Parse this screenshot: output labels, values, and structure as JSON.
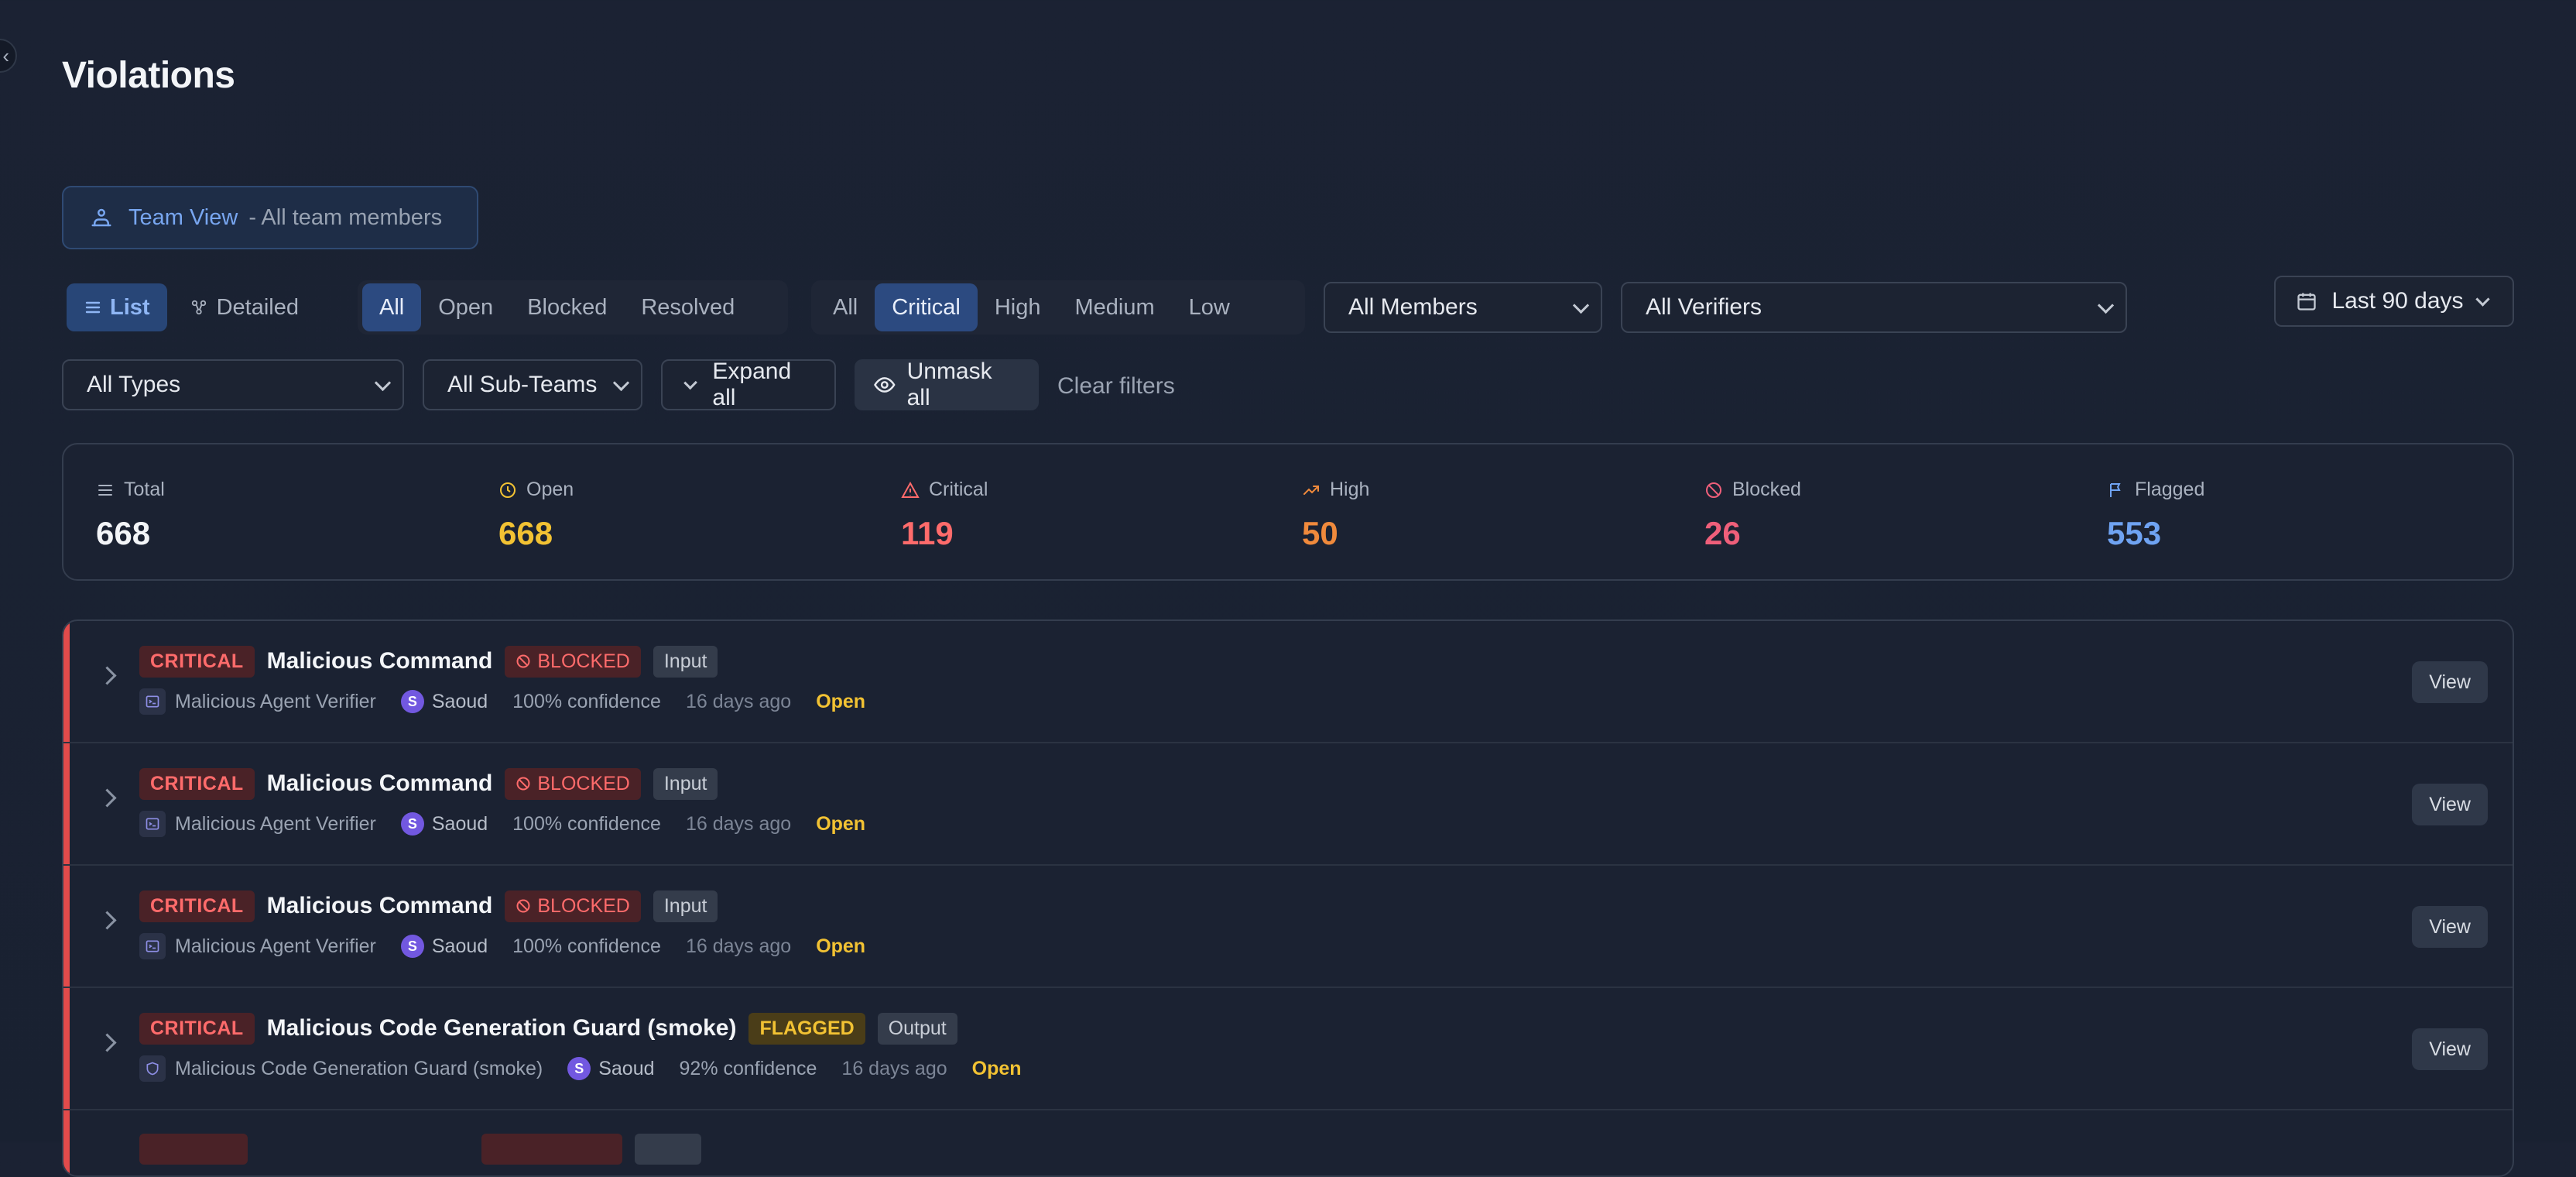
{
  "page": {
    "title": "Violations"
  },
  "team_view": {
    "label": "Team View",
    "sub": "- All team members"
  },
  "view_mode": {
    "list": "List",
    "detailed": "Detailed"
  },
  "status_filter": [
    "All",
    "Open",
    "Blocked",
    "Resolved"
  ],
  "severity_filter": [
    "All",
    "Critical",
    "High",
    "Medium",
    "Low"
  ],
  "members_select": "All Members",
  "verifiers_select": "All Verifiers",
  "date_range": "Last 90 days",
  "types_select": "All Types",
  "subteams_select": "All Sub-Teams",
  "expand_all": "Expand all",
  "unmask_all": "Unmask all",
  "clear_filters": "Clear filters",
  "stats": {
    "total": {
      "label": "Total",
      "value": "668"
    },
    "open": {
      "label": "Open",
      "value": "668"
    },
    "critical": {
      "label": "Critical",
      "value": "119"
    },
    "high": {
      "label": "High",
      "value": "50"
    },
    "blocked": {
      "label": "Blocked",
      "value": "26"
    },
    "flagged": {
      "label": "Flagged",
      "value": "553"
    }
  },
  "colors": {
    "accent_blue": "#78a6f0",
    "critical_red": "#ff6b6b",
    "open_yellow": "#f2c233",
    "high_orange": "#f08a3c",
    "blocked_pink": "#ef5f7a",
    "flagged_blue": "#6fa3f2"
  },
  "rows": [
    {
      "severity": "CRITICAL",
      "title": "Malicious Command",
      "action": "BLOCKED",
      "io": "Input",
      "verifier": "Malicious Agent Verifier",
      "avatar": "S",
      "user": "Saoud",
      "confidence": "100% confidence",
      "time": "16 days ago",
      "status": "Open",
      "view": "View"
    },
    {
      "severity": "CRITICAL",
      "title": "Malicious Command",
      "action": "BLOCKED",
      "io": "Input",
      "verifier": "Malicious Agent Verifier",
      "avatar": "S",
      "user": "Saoud",
      "confidence": "100% confidence",
      "time": "16 days ago",
      "status": "Open",
      "view": "View"
    },
    {
      "severity": "CRITICAL",
      "title": "Malicious Command",
      "action": "BLOCKED",
      "io": "Input",
      "verifier": "Malicious Agent Verifier",
      "avatar": "S",
      "user": "Saoud",
      "confidence": "100% confidence",
      "time": "16 days ago",
      "status": "Open",
      "view": "View"
    },
    {
      "severity": "CRITICAL",
      "title": "Malicious Code Generation Guard (smoke)",
      "action": "FLAGGED",
      "io": "Output",
      "verifier": "Malicious Code Generation Guard (smoke)",
      "avatar": "S",
      "user": "Saoud",
      "confidence": "92% confidence",
      "time": "16 days ago",
      "status": "Open",
      "view": "View"
    }
  ]
}
